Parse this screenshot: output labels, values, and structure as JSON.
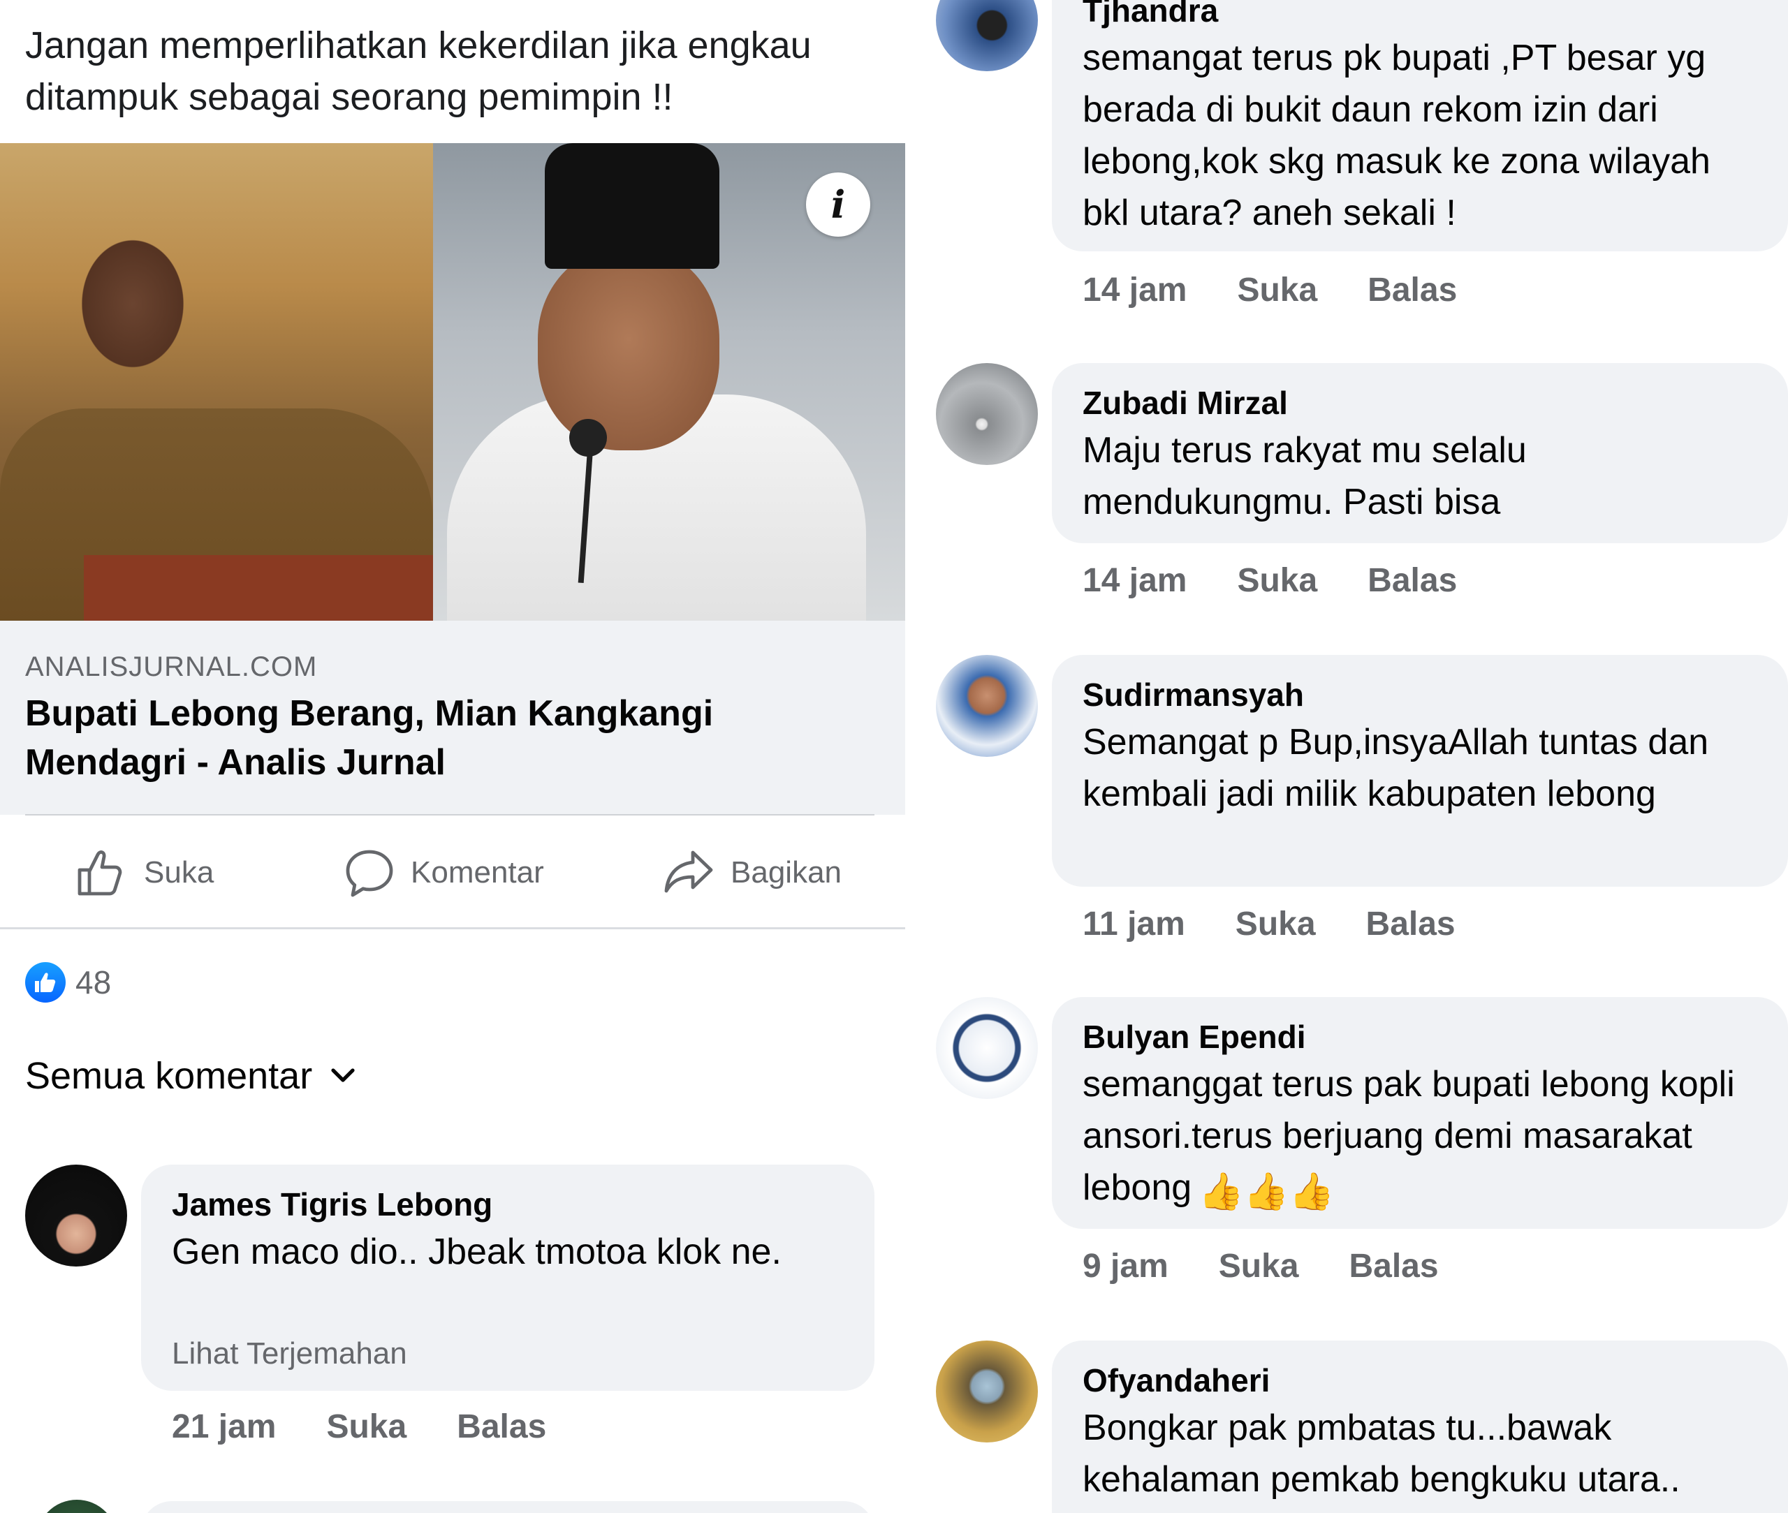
{
  "post": {
    "caption": "Jangan memperlihatkan kekerdilan jika engkau ditampuk sebagai seorang pemimpin !!",
    "info_icon_glyph": "i",
    "link": {
      "domain": "ANALISJURNAL.COM",
      "title": "Bupati Lebong Berang, Mian Kangkangi Mendagri - Analis Jurnal"
    }
  },
  "actions": {
    "like": "Suka",
    "comment": "Komentar",
    "share": "Bagikan"
  },
  "reactions": {
    "count": "48"
  },
  "filter": {
    "label": "Semua komentar"
  },
  "left_comments": [
    {
      "name": "James Tigris Lebong",
      "text": "Gen maco dio.. Jbeak tmotoa klok ne.",
      "translate": "Lihat Terjemahan",
      "time": "21 jam",
      "like": "Suka",
      "reply": "Balas"
    }
  ],
  "right_comments": [
    {
      "name": "Tjhandra",
      "text": "semangat terus pk bupati ,PT besar yg berada di bukit daun rekom izin dari lebong,kok skg masuk ke zona wilayah bkl  utara? aneh sekali !",
      "time": "14 jam",
      "like": "Suka",
      "reply": "Balas"
    },
    {
      "name": "Zubadi Mirzal",
      "text": "Maju terus rakyat mu selalu mendukungmu. Pasti bisa",
      "time": "14 jam",
      "like": "Suka",
      "reply": "Balas"
    },
    {
      "name": "Sudirmansyah",
      "text": "Semangat p Bup,insyaAllah tuntas dan kembali jadi milik kabupaten lebong",
      "time": "11 jam",
      "like": "Suka",
      "reply": "Balas"
    },
    {
      "name": "Bulyan Ependi",
      "text": "semanggat terus pak bupati lebong kopli ansori.terus berjuang demi masarakat lebong",
      "emoji": "👍👍👍",
      "time": "9 jam",
      "like": "Suka",
      "reply": "Balas"
    },
    {
      "name": "Ofyandaheri",
      "text": "Bongkar pak pmbatas tu...bawak kehalaman pemkab bengkuku utara..",
      "time": "",
      "like": "",
      "reply": ""
    }
  ],
  "colors": {
    "bubble": "#f0f2f5",
    "secondary_text": "#65676b",
    "like_blue": "#0866ff"
  }
}
